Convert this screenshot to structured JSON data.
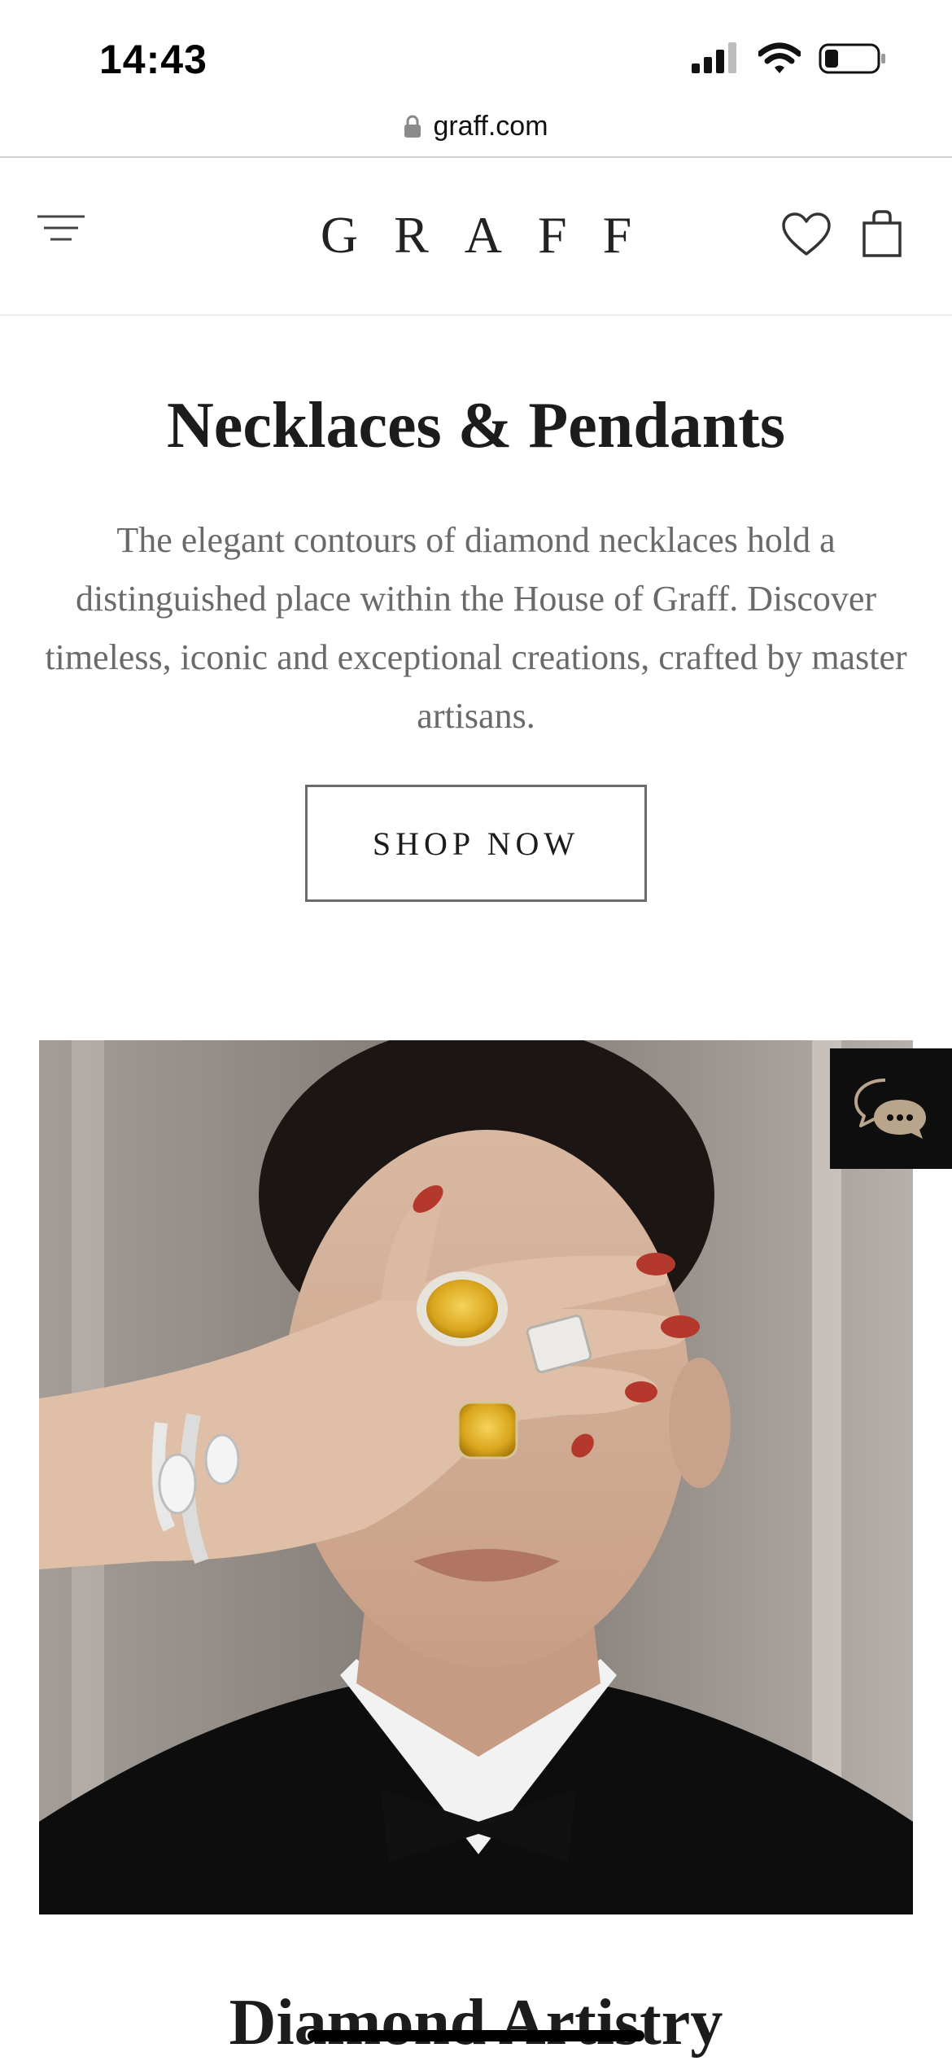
{
  "status_bar": {
    "time": "14:43",
    "icons": [
      "cellular-signal-icon",
      "wifi-icon",
      "battery-icon"
    ]
  },
  "browser": {
    "url": "graff.com",
    "icons": [
      "lock-icon"
    ]
  },
  "header": {
    "logo": "GRAFF",
    "icons": [
      "hamburger-menu-icon",
      "heart-icon",
      "shopping-bag-icon"
    ]
  },
  "intro": {
    "title": "Necklaces & Pendants",
    "description": "The elegant contours of diamond necklaces hold a distinguished place within the House of Graff. Discover timeless, iconic and exceptional creations, crafted by master artisans.",
    "cta_label": "SHOP NOW"
  },
  "hero": {
    "alt_subject": "model-with-diamond-rings"
  },
  "chat": {
    "icon": "chat-bubbles-icon"
  },
  "next_section": {
    "title": "Diamond Artistry"
  },
  "colors": {
    "accent": "#1c1c1c",
    "body_text": "#6a6a6a",
    "chat_bg": "#0e0e0e",
    "chat_icon": "#b9a58c"
  }
}
